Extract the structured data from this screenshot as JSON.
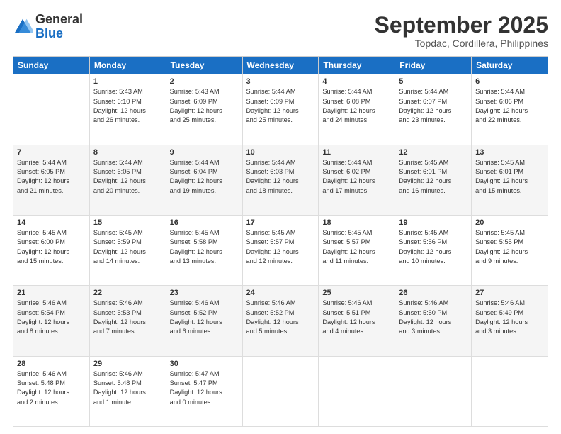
{
  "logo": {
    "general": "General",
    "blue": "Blue"
  },
  "header": {
    "month": "September 2025",
    "location": "Topdac, Cordillera, Philippines"
  },
  "weekdays": [
    "Sunday",
    "Monday",
    "Tuesday",
    "Wednesday",
    "Thursday",
    "Friday",
    "Saturday"
  ],
  "weeks": [
    [
      {
        "day": "",
        "info": ""
      },
      {
        "day": "1",
        "info": "Sunrise: 5:43 AM\nSunset: 6:10 PM\nDaylight: 12 hours\nand 26 minutes."
      },
      {
        "day": "2",
        "info": "Sunrise: 5:43 AM\nSunset: 6:09 PM\nDaylight: 12 hours\nand 25 minutes."
      },
      {
        "day": "3",
        "info": "Sunrise: 5:44 AM\nSunset: 6:09 PM\nDaylight: 12 hours\nand 25 minutes."
      },
      {
        "day": "4",
        "info": "Sunrise: 5:44 AM\nSunset: 6:08 PM\nDaylight: 12 hours\nand 24 minutes."
      },
      {
        "day": "5",
        "info": "Sunrise: 5:44 AM\nSunset: 6:07 PM\nDaylight: 12 hours\nand 23 minutes."
      },
      {
        "day": "6",
        "info": "Sunrise: 5:44 AM\nSunset: 6:06 PM\nDaylight: 12 hours\nand 22 minutes."
      }
    ],
    [
      {
        "day": "7",
        "info": "Sunrise: 5:44 AM\nSunset: 6:05 PM\nDaylight: 12 hours\nand 21 minutes."
      },
      {
        "day": "8",
        "info": "Sunrise: 5:44 AM\nSunset: 6:05 PM\nDaylight: 12 hours\nand 20 minutes."
      },
      {
        "day": "9",
        "info": "Sunrise: 5:44 AM\nSunset: 6:04 PM\nDaylight: 12 hours\nand 19 minutes."
      },
      {
        "day": "10",
        "info": "Sunrise: 5:44 AM\nSunset: 6:03 PM\nDaylight: 12 hours\nand 18 minutes."
      },
      {
        "day": "11",
        "info": "Sunrise: 5:44 AM\nSunset: 6:02 PM\nDaylight: 12 hours\nand 17 minutes."
      },
      {
        "day": "12",
        "info": "Sunrise: 5:45 AM\nSunset: 6:01 PM\nDaylight: 12 hours\nand 16 minutes."
      },
      {
        "day": "13",
        "info": "Sunrise: 5:45 AM\nSunset: 6:01 PM\nDaylight: 12 hours\nand 15 minutes."
      }
    ],
    [
      {
        "day": "14",
        "info": "Sunrise: 5:45 AM\nSunset: 6:00 PM\nDaylight: 12 hours\nand 15 minutes."
      },
      {
        "day": "15",
        "info": "Sunrise: 5:45 AM\nSunset: 5:59 PM\nDaylight: 12 hours\nand 14 minutes."
      },
      {
        "day": "16",
        "info": "Sunrise: 5:45 AM\nSunset: 5:58 PM\nDaylight: 12 hours\nand 13 minutes."
      },
      {
        "day": "17",
        "info": "Sunrise: 5:45 AM\nSunset: 5:57 PM\nDaylight: 12 hours\nand 12 minutes."
      },
      {
        "day": "18",
        "info": "Sunrise: 5:45 AM\nSunset: 5:57 PM\nDaylight: 12 hours\nand 11 minutes."
      },
      {
        "day": "19",
        "info": "Sunrise: 5:45 AM\nSunset: 5:56 PM\nDaylight: 12 hours\nand 10 minutes."
      },
      {
        "day": "20",
        "info": "Sunrise: 5:45 AM\nSunset: 5:55 PM\nDaylight: 12 hours\nand 9 minutes."
      }
    ],
    [
      {
        "day": "21",
        "info": "Sunrise: 5:46 AM\nSunset: 5:54 PM\nDaylight: 12 hours\nand 8 minutes."
      },
      {
        "day": "22",
        "info": "Sunrise: 5:46 AM\nSunset: 5:53 PM\nDaylight: 12 hours\nand 7 minutes."
      },
      {
        "day": "23",
        "info": "Sunrise: 5:46 AM\nSunset: 5:52 PM\nDaylight: 12 hours\nand 6 minutes."
      },
      {
        "day": "24",
        "info": "Sunrise: 5:46 AM\nSunset: 5:52 PM\nDaylight: 12 hours\nand 5 minutes."
      },
      {
        "day": "25",
        "info": "Sunrise: 5:46 AM\nSunset: 5:51 PM\nDaylight: 12 hours\nand 4 minutes."
      },
      {
        "day": "26",
        "info": "Sunrise: 5:46 AM\nSunset: 5:50 PM\nDaylight: 12 hours\nand 3 minutes."
      },
      {
        "day": "27",
        "info": "Sunrise: 5:46 AM\nSunset: 5:49 PM\nDaylight: 12 hours\nand 3 minutes."
      }
    ],
    [
      {
        "day": "28",
        "info": "Sunrise: 5:46 AM\nSunset: 5:48 PM\nDaylight: 12 hours\nand 2 minutes."
      },
      {
        "day": "29",
        "info": "Sunrise: 5:46 AM\nSunset: 5:48 PM\nDaylight: 12 hours\nand 1 minute."
      },
      {
        "day": "30",
        "info": "Sunrise: 5:47 AM\nSunset: 5:47 PM\nDaylight: 12 hours\nand 0 minutes."
      },
      {
        "day": "",
        "info": ""
      },
      {
        "day": "",
        "info": ""
      },
      {
        "day": "",
        "info": ""
      },
      {
        "day": "",
        "info": ""
      }
    ]
  ]
}
